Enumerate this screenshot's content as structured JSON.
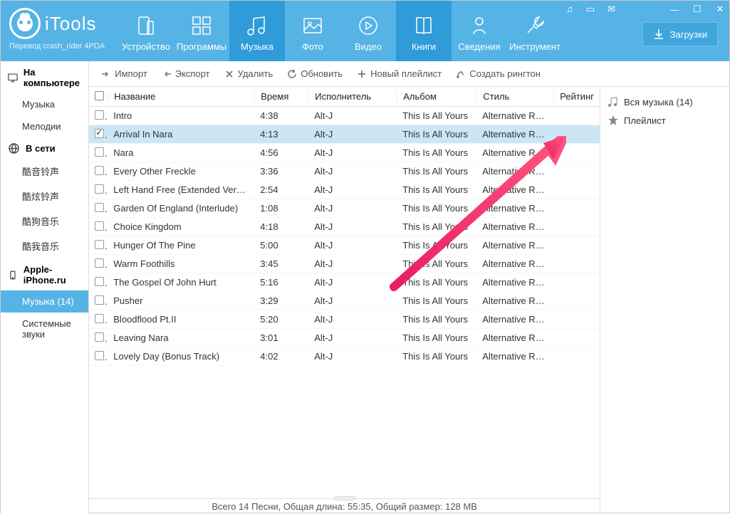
{
  "app": {
    "name": "iTools",
    "subtitle": "Перевод crash_rider 4PDA"
  },
  "nav": {
    "device": "Устройство",
    "programs": "Программы",
    "music": "Музыка",
    "photo": "Фото",
    "video": "Видео",
    "books": "Книги",
    "info": "Сведения",
    "tools": "Инструмент",
    "active_tabs": [
      "music",
      "books"
    ]
  },
  "downloads_btn": "Загрузки",
  "sidebar_left": {
    "sections": [
      {
        "title": "На компьютере",
        "icon": "monitor",
        "items": [
          "Музыка",
          "Мелодии"
        ]
      },
      {
        "title": "В сети",
        "icon": "globe",
        "items": [
          "酷音铃声",
          "酷炫铃声",
          "酷狗音乐",
          "酷我音乐"
        ]
      },
      {
        "title": "Apple-iPhone.ru",
        "icon": "phone",
        "items": [
          "Музыка (14)",
          "Системные звуки"
        ],
        "active_item": "Музыка (14)"
      }
    ]
  },
  "toolbar": {
    "import": "Импорт",
    "export": "Экспорт",
    "delete": "Удалить",
    "refresh": "Обновить",
    "new_playlist": "Новый плейлист",
    "create_ringtone": "Создать рингтон"
  },
  "table": {
    "headers": {
      "name": "Название",
      "time": "Время",
      "artist": "Исполнитель",
      "album": "Альбом",
      "genre": "Стиль",
      "rating": "Рейтинг"
    },
    "selected_row": 1,
    "rows": [
      {
        "name": "Intro",
        "time": "4:38",
        "artist": "Alt-J",
        "album": "This Is All Yours",
        "genre": "Alternative Rock..."
      },
      {
        "name": "Arrival In Nara",
        "time": "4:13",
        "artist": "Alt-J",
        "album": "This Is All Yours",
        "genre": "Alternative Rock..."
      },
      {
        "name": "Nara",
        "time": "4:56",
        "artist": "Alt-J",
        "album": "This Is All Yours",
        "genre": "Alternative Rock..."
      },
      {
        "name": "Every Other Freckle",
        "time": "3:36",
        "artist": "Alt-J",
        "album": "This Is All Yours",
        "genre": "Alternative Rock..."
      },
      {
        "name": "Left Hand Free (Extended Version)",
        "time": "2:54",
        "artist": "Alt-J",
        "album": "This Is All Yours",
        "genre": "Alternative Rock..."
      },
      {
        "name": "Garden Of England (Interlude)",
        "time": "1:08",
        "artist": "Alt-J",
        "album": "This Is All Yours",
        "genre": "Alternative Rock..."
      },
      {
        "name": "Choice Kingdom",
        "time": "4:18",
        "artist": "Alt-J",
        "album": "This Is All Yours",
        "genre": "Alternative Rock..."
      },
      {
        "name": "Hunger Of The Pine",
        "time": "5:00",
        "artist": "Alt-J",
        "album": "This Is All Yours",
        "genre": "Alternative Rock..."
      },
      {
        "name": "Warm Foothills",
        "time": "3:45",
        "artist": "Alt-J",
        "album": "This Is All Yours",
        "genre": "Alternative Rock..."
      },
      {
        "name": "The Gospel Of John Hurt",
        "time": "5:16",
        "artist": "Alt-J",
        "album": "This Is All Yours",
        "genre": "Alternative Rock..."
      },
      {
        "name": "Pusher",
        "time": "3:29",
        "artist": "Alt-J",
        "album": "This Is All Yours",
        "genre": "Alternative Rock..."
      },
      {
        "name": "Bloodflood Pt.II",
        "time": "5:20",
        "artist": "Alt-J",
        "album": "This Is All Yours",
        "genre": "Alternative Rock..."
      },
      {
        "name": "Leaving Nara",
        "time": "3:01",
        "artist": "Alt-J",
        "album": "This Is All Yours",
        "genre": "Alternative Rock..."
      },
      {
        "name": "Lovely Day (Bonus Track)",
        "time": "4:02",
        "artist": "Alt-J",
        "album": "This Is All Yours",
        "genre": "Alternative Rock..."
      }
    ]
  },
  "sidebar_right": {
    "all_music": "Вся музыка (14)",
    "playlist": "Плейлист"
  },
  "statusbar": "Всего 14 Песни, Общая длина: 55:35, Общий размер: 128 MB"
}
